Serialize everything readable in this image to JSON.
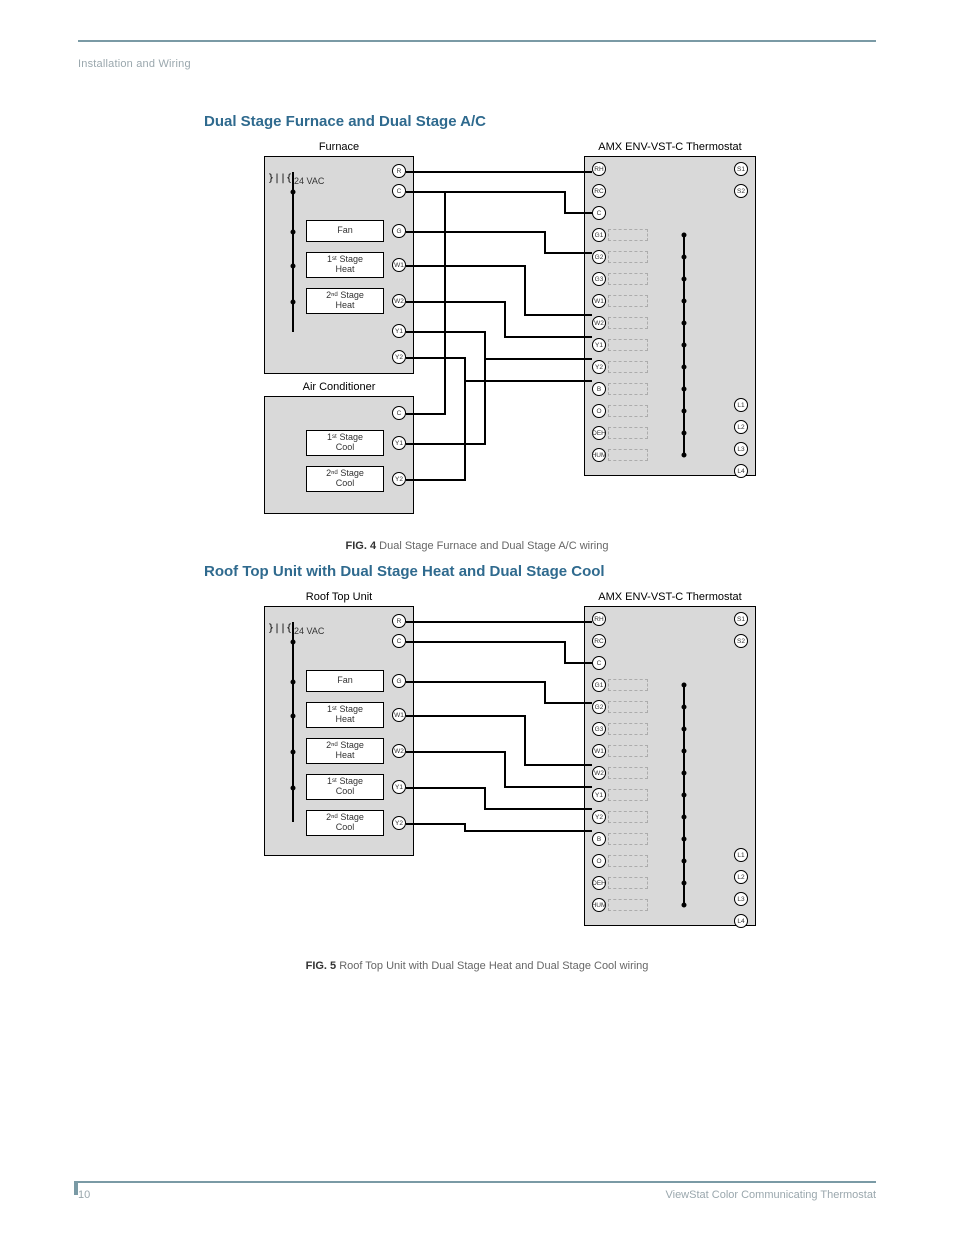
{
  "section_header": "Installation and Wiring",
  "heading1": "Dual Stage Furnace and Dual Stage A/C",
  "heading2": "Roof Top Unit with Dual Stage Heat and Dual Stage Cool",
  "caption1_bold": "FIG. 4",
  "caption1_text": "  Dual Stage Furnace and Dual Stage A/C wiring",
  "caption2_bold": "FIG. 5",
  "caption2_text": "  Roof Top Unit with Dual Stage Heat and Dual Stage Cool wiring",
  "footer_page": "10",
  "footer_title": "ViewStat Color Communicating Thermostat",
  "diagram1": {
    "left_title_a": "Furnace",
    "left_title_b": "Air Conditioner",
    "right_title": "AMX ENV-VST-C Thermostat",
    "vac": "24 VAC",
    "left_boxes_a": [
      "Fan",
      "1ˢᵗ Stage\nHeat",
      "2ⁿᵈ Stage\nHeat"
    ],
    "left_terms_a": [
      "R",
      "C",
      "G",
      "W1",
      "W2",
      "Y1",
      "Y2"
    ],
    "left_boxes_b": [
      "1ˢᵗ Stage\nCool",
      "2ⁿᵈ Stage\nCool"
    ],
    "left_terms_b": [
      "C",
      "Y1",
      "Y2"
    ],
    "right_terms_left": [
      "RH",
      "RC",
      "C",
      "G1",
      "G2",
      "G3",
      "W1",
      "W2",
      "Y1",
      "Y2",
      "B",
      "O",
      "DEH",
      "HUM"
    ],
    "right_terms_right": [
      "S1",
      "S2",
      "L1",
      "L2",
      "L3",
      "L4"
    ]
  },
  "diagram2": {
    "left_title": "Roof Top Unit",
    "right_title": "AMX ENV-VST-C Thermostat",
    "vac": "24 VAC",
    "left_boxes": [
      "Fan",
      "1ˢᵗ Stage\nHeat",
      "2ⁿᵈ Stage\nHeat",
      "1ˢᵗ Stage\nCool",
      "2ⁿᵈ Stage\nCool"
    ],
    "left_terms": [
      "R",
      "C",
      "G",
      "W1",
      "W2",
      "Y1",
      "Y2"
    ],
    "right_terms_left": [
      "RH",
      "RC",
      "C",
      "G1",
      "G2",
      "G3",
      "W1",
      "W2",
      "Y1",
      "Y2",
      "B",
      "O",
      "DEH",
      "HUM"
    ],
    "right_terms_right": [
      "S1",
      "S2",
      "L1",
      "L2",
      "L3",
      "L4"
    ]
  }
}
